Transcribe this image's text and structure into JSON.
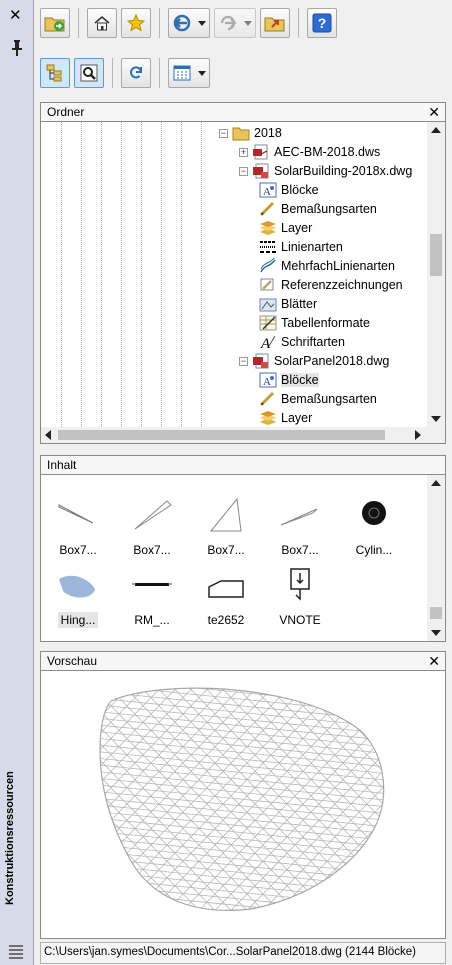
{
  "palette": {
    "title": "Konstruktionsressourcen"
  },
  "toolbar": {
    "buttons": [
      "load-folder",
      "home",
      "favorites",
      "back",
      "forward",
      "up",
      "help",
      "tree-toggle",
      "preview",
      "refresh",
      "views"
    ]
  },
  "folders": {
    "title": "Ordner",
    "items": [
      {
        "label": "2018",
        "icon": "folder-icon"
      },
      {
        "label": "AEC-BM-2018.dws",
        "icon": "dws-file-icon"
      },
      {
        "label": "SolarBuilding-2018x.dwg",
        "icon": "dwg-file-icon"
      },
      {
        "label": "Blöcke",
        "icon": "blocks-icon"
      },
      {
        "label": "Bemaßungsarten",
        "icon": "dimstyle-icon"
      },
      {
        "label": "Layer",
        "icon": "layer-icon"
      },
      {
        "label": "Linienarten",
        "icon": "linetype-icon"
      },
      {
        "label": "MehrfachLinienarten",
        "icon": "mlinestyle-icon"
      },
      {
        "label": "Referenzzeichnungen",
        "icon": "xref-icon"
      },
      {
        "label": "Blätter",
        "icon": "layout-icon"
      },
      {
        "label": "Tabellenformate",
        "icon": "tablestyle-icon"
      },
      {
        "label": "Schriftarten",
        "icon": "textstyle-icon"
      },
      {
        "label": "SolarPanel2018.dwg",
        "icon": "dwg-file-icon"
      },
      {
        "label": "Blöcke",
        "icon": "blocks-icon"
      },
      {
        "label": "Bemaßungsarten",
        "icon": "dimstyle-icon"
      },
      {
        "label": "Layer",
        "icon": "layer-icon"
      }
    ]
  },
  "content": {
    "title": "Inhalt",
    "items": [
      {
        "name": "Box7...",
        "icon": "box-wedge-icon"
      },
      {
        "name": "Box7...",
        "icon": "box-wedge-icon"
      },
      {
        "name": "Box7...",
        "icon": "box-wedge-icon"
      },
      {
        "name": "Box7...",
        "icon": "box-wedge-icon"
      },
      {
        "name": "Cylin...",
        "icon": "cylinder-icon"
      },
      {
        "name": "Hing...",
        "icon": "hinge-icon"
      },
      {
        "name": "RM_...",
        "icon": "rm-block-icon"
      },
      {
        "name": "te2652",
        "icon": "te-block-icon"
      },
      {
        "name": "VNOTE",
        "icon": "vnote-icon"
      }
    ]
  },
  "preview": {
    "title": "Vorschau"
  },
  "status": {
    "text": "C:\\Users\\jan.symes\\Documents\\Cor...SolarPanel2018.dwg (2144 Blöcke)"
  }
}
